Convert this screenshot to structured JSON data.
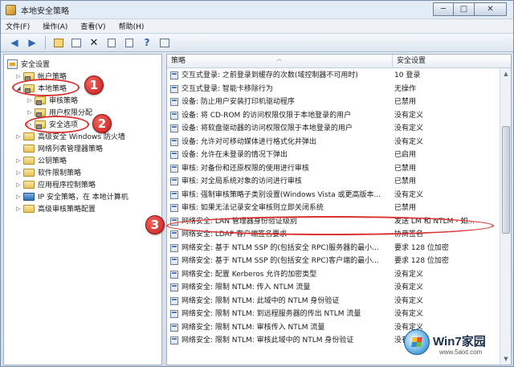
{
  "window": {
    "title": "本地安全策略",
    "controls": [
      "─",
      "□",
      "✕"
    ]
  },
  "menu": [
    "文件(F)",
    "操作(A)",
    "查看(V)",
    "帮助(H)"
  ],
  "toolbar_icons": [
    "back-arrow-icon",
    "forward-arrow-icon",
    "up-folder-icon",
    "show-hide-tree-icon",
    "delete-icon",
    "properties-icon",
    "export-list-icon",
    "help-icon",
    "console-icon"
  ],
  "tree": {
    "root": "安全设置",
    "items": [
      {
        "label": "帐户策略",
        "level": 1,
        "expanded": false
      },
      {
        "label": "本地策略",
        "level": 1,
        "expanded": true,
        "selected_outline": true
      },
      {
        "label": "审核策略",
        "level": 2,
        "expanded": false
      },
      {
        "label": "用户权限分配",
        "level": 2,
        "expanded": false
      },
      {
        "label": "安全选项",
        "level": 2,
        "expanded": false,
        "selected": true
      },
      {
        "label": "高级安全 Windows 防火墙",
        "level": 1,
        "expanded": false
      },
      {
        "label": "网络列表管理器策略",
        "level": 1,
        "expanded": null
      },
      {
        "label": "公钥策略",
        "level": 1,
        "expanded": false
      },
      {
        "label": "软件限制策略",
        "level": 1,
        "expanded": false
      },
      {
        "label": "应用程序控制策略",
        "level": 1,
        "expanded": false
      },
      {
        "label": "IP 安全策略，在 本地计算机",
        "level": 1,
        "expanded": false
      },
      {
        "label": "高级审核策略配置",
        "level": 1,
        "expanded": false
      }
    ]
  },
  "list": {
    "columns": [
      "策略",
      "安全设置"
    ],
    "rows": [
      {
        "policy": "交互式登录: 之前登录到缓存的次数(域控制器不可用时)",
        "setting": "10 登录"
      },
      {
        "policy": "交互式登录: 智能卡移除行为",
        "setting": "无操作"
      },
      {
        "policy": "设备: 防止用户安装打印机驱动程序",
        "setting": "已禁用"
      },
      {
        "policy": "设备: 将 CD-ROM 的访问权限仅限于本地登录的用户",
        "setting": "没有定义"
      },
      {
        "policy": "设备: 将软盘驱动器的访问权限仅限于本地登录的用户",
        "setting": "没有定义"
      },
      {
        "policy": "设备: 允许对可移动媒体进行格式化并弹出",
        "setting": "没有定义"
      },
      {
        "policy": "设备: 允许在未登录的情况下弹出",
        "setting": "已启用"
      },
      {
        "policy": "审核: 对备份和还原权限的使用进行审核",
        "setting": "已禁用"
      },
      {
        "policy": "审核: 对全局系统对象的访问进行审核",
        "setting": "已禁用"
      },
      {
        "policy": "审核: 强制审核策略子类别设置(Windows Vista 或更高版本...",
        "setting": "没有定义"
      },
      {
        "policy": "审核: 如果无法记录安全审核则立即关闭系统",
        "setting": "已禁用"
      },
      {
        "policy": "网络安全: LAN 管理器身份验证级别",
        "setting": "发送 LM 和 NTLM - 如...",
        "highlighted": true
      },
      {
        "policy": "网络安全: LDAP 客户端签名要求",
        "setting": "协商签名"
      },
      {
        "policy": "网络安全: 基于 NTLM SSP 的(包括安全 RPC)服务器的最小...",
        "setting": "要求 128 位加密"
      },
      {
        "policy": "网络安全: 基于 NTLM SSP 的(包括安全 RPC)客户端的最小...",
        "setting": "要求 128 位加密"
      },
      {
        "policy": "网络安全: 配置 Kerberos 允许的加密类型",
        "setting": "没有定义"
      },
      {
        "policy": "网络安全: 限制 NTLM: 传入 NTLM 流量",
        "setting": "没有定义"
      },
      {
        "policy": "网络安全: 限制 NTLM: 此域中的 NTLM 身份验证",
        "setting": "没有定义"
      },
      {
        "policy": "网络安全: 限制 NTLM: 到远程服务器的传出 NTLM 流量",
        "setting": "没有定义"
      },
      {
        "policy": "网络安全: 限制 NTLM: 审核传入 NTLM 流量",
        "setting": "没有定义"
      },
      {
        "policy": "网络安全: 限制 NTLM: 审核此域中的 NTLM 身份验证",
        "setting": "没有定义"
      }
    ]
  },
  "annotations": {
    "badges": [
      "1",
      "2",
      "3"
    ],
    "color": "#d93232"
  },
  "watermark": {
    "brand": "Win7家园",
    "url": "www.5aixt.com"
  },
  "colors": {
    "window_bg": "#d2deeb",
    "pane_bg": "#ffffff",
    "annotation_red": "#d93232"
  }
}
